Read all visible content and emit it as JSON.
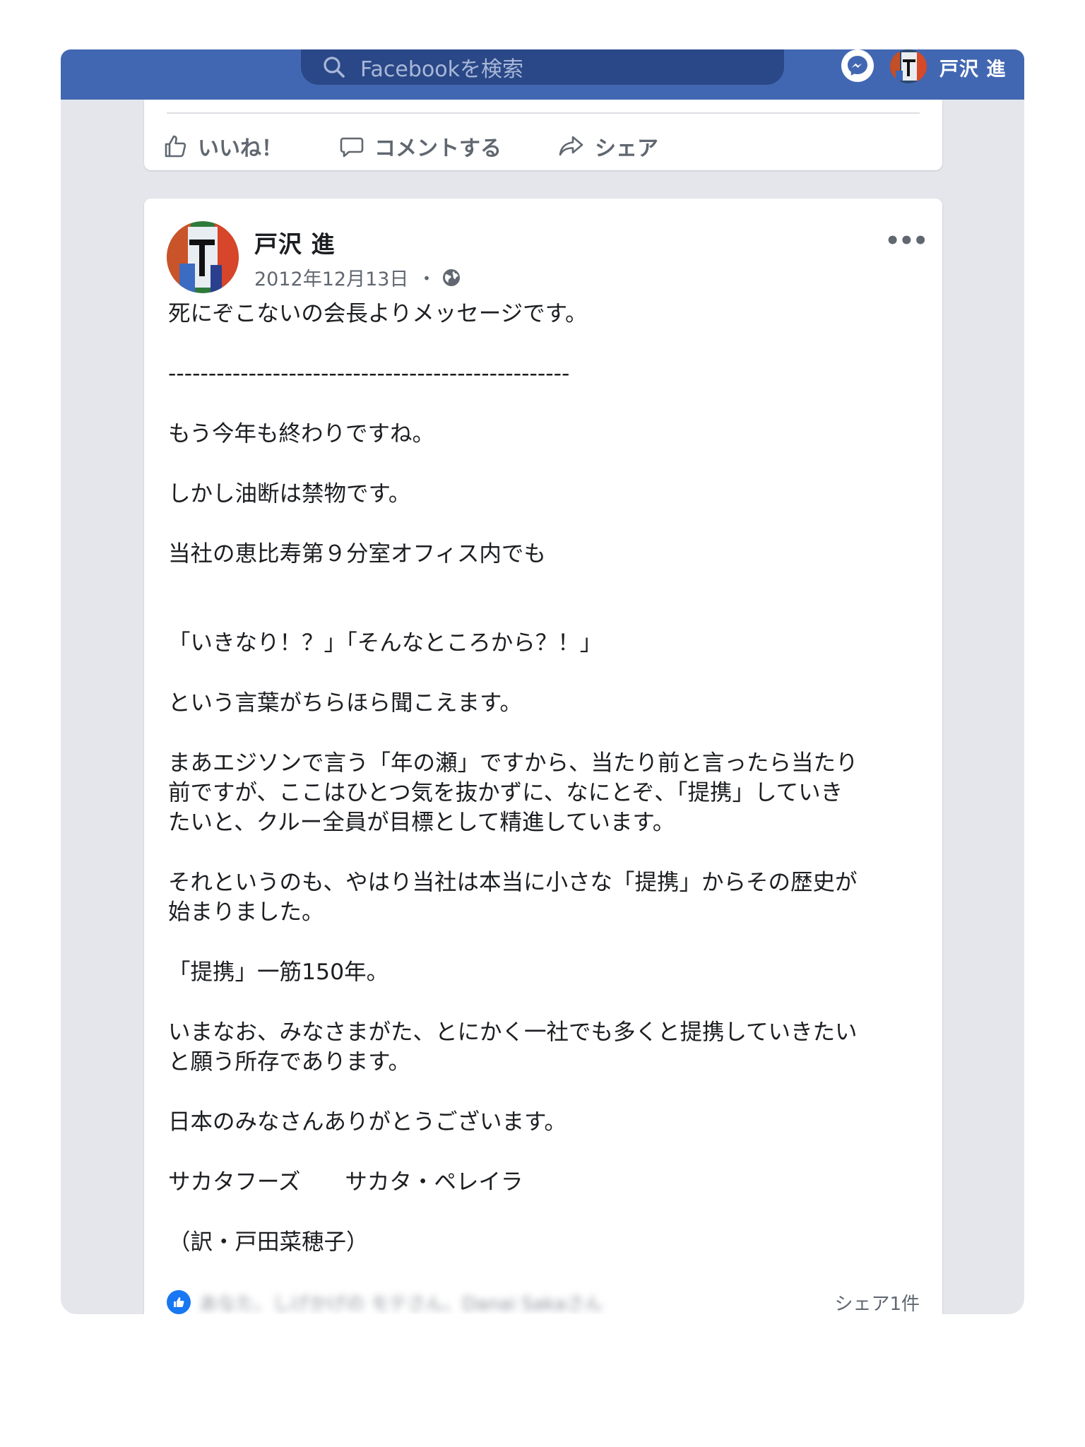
{
  "topbar": {
    "search_placeholder": "Facebookを検索",
    "user_name": "戸沢 進"
  },
  "top_card": {
    "actions": {
      "like": "いいね！",
      "comment": "コメントする",
      "share": "シェア"
    }
  },
  "post": {
    "author": "戸沢 進",
    "date": "2012年12月13日",
    "separator": "・",
    "privacy_icon": "globe-icon",
    "more_icon": "more-icon",
    "more_glyph": "•••",
    "lines": [
      "死にぞこないの会長よりメッセージです。",
      "--------------------------------------------------",
      "もう今年も終わりですね。",
      "しかし油断は禁物です。",
      "当社の恵比寿第９分室オフィス内でも",
      "「いきなり！？」「そんなところから？！」",
      "という言葉がちらほら聞こえます。",
      "まあエジソンで言う「年の瀬」ですから、当たり前と言ったら当たり",
      "前ですが、ここはひとつ気を抜かずに、なにとぞ、「提携」していき",
      "たいと、クルー全員が目標として精進しています。",
      "それというのも、やはり当社は本当に小さな「提携」からその歴史が",
      "始まりました。",
      "「提携」一筋150年。",
      "いまなお、みなさまがた、とにかく一社でも多くと提携していきたい",
      "と願う所存であります。",
      "日本のみなさんありがとうございます。",
      "サカタフーズ　　サカタ・ペレイラ",
      "（訳・戸田菜穂子）"
    ],
    "reactors": "あなた、しげかげの モテさん、Danai Sakaさん",
    "shares": "シェア1件"
  },
  "colors": {
    "brand": "#4267b2",
    "search_bg": "#2a4887",
    "feed_bg": "#e4e6eb",
    "like_blue": "#1877f2",
    "text_secondary": "#606770"
  }
}
